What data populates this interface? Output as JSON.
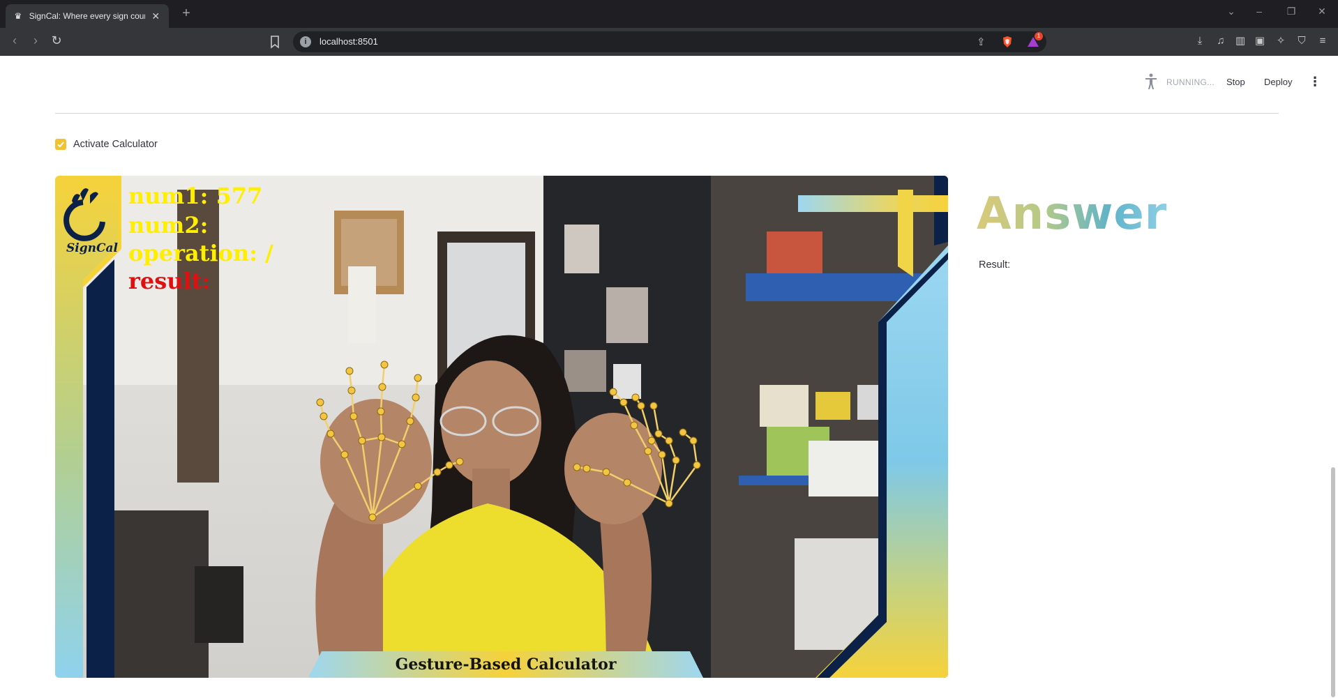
{
  "browser": {
    "tab_title": "SignCal: Where every sign counts",
    "new_tab_symbol": "+",
    "url": "localhost:8501",
    "rewards_badge": "1",
    "window_controls": [
      "⌄",
      "–",
      "❐",
      "✕"
    ]
  },
  "header": {
    "status": "RUNNING...",
    "stop_label": "Stop",
    "deploy_label": "Deploy",
    "menu_symbol": "⋮"
  },
  "controls": {
    "activate_label": "Activate Calculator",
    "activate_checked": true,
    "accent_color": "#f2c233"
  },
  "video": {
    "num1": "num1: 577",
    "num2": "num2:",
    "operation": "operation: /",
    "result": "result:",
    "logo_text": "SignCal",
    "footer": "Gesture-Based Calculator"
  },
  "answer": {
    "title": "Answer",
    "result_label": "Result:"
  }
}
